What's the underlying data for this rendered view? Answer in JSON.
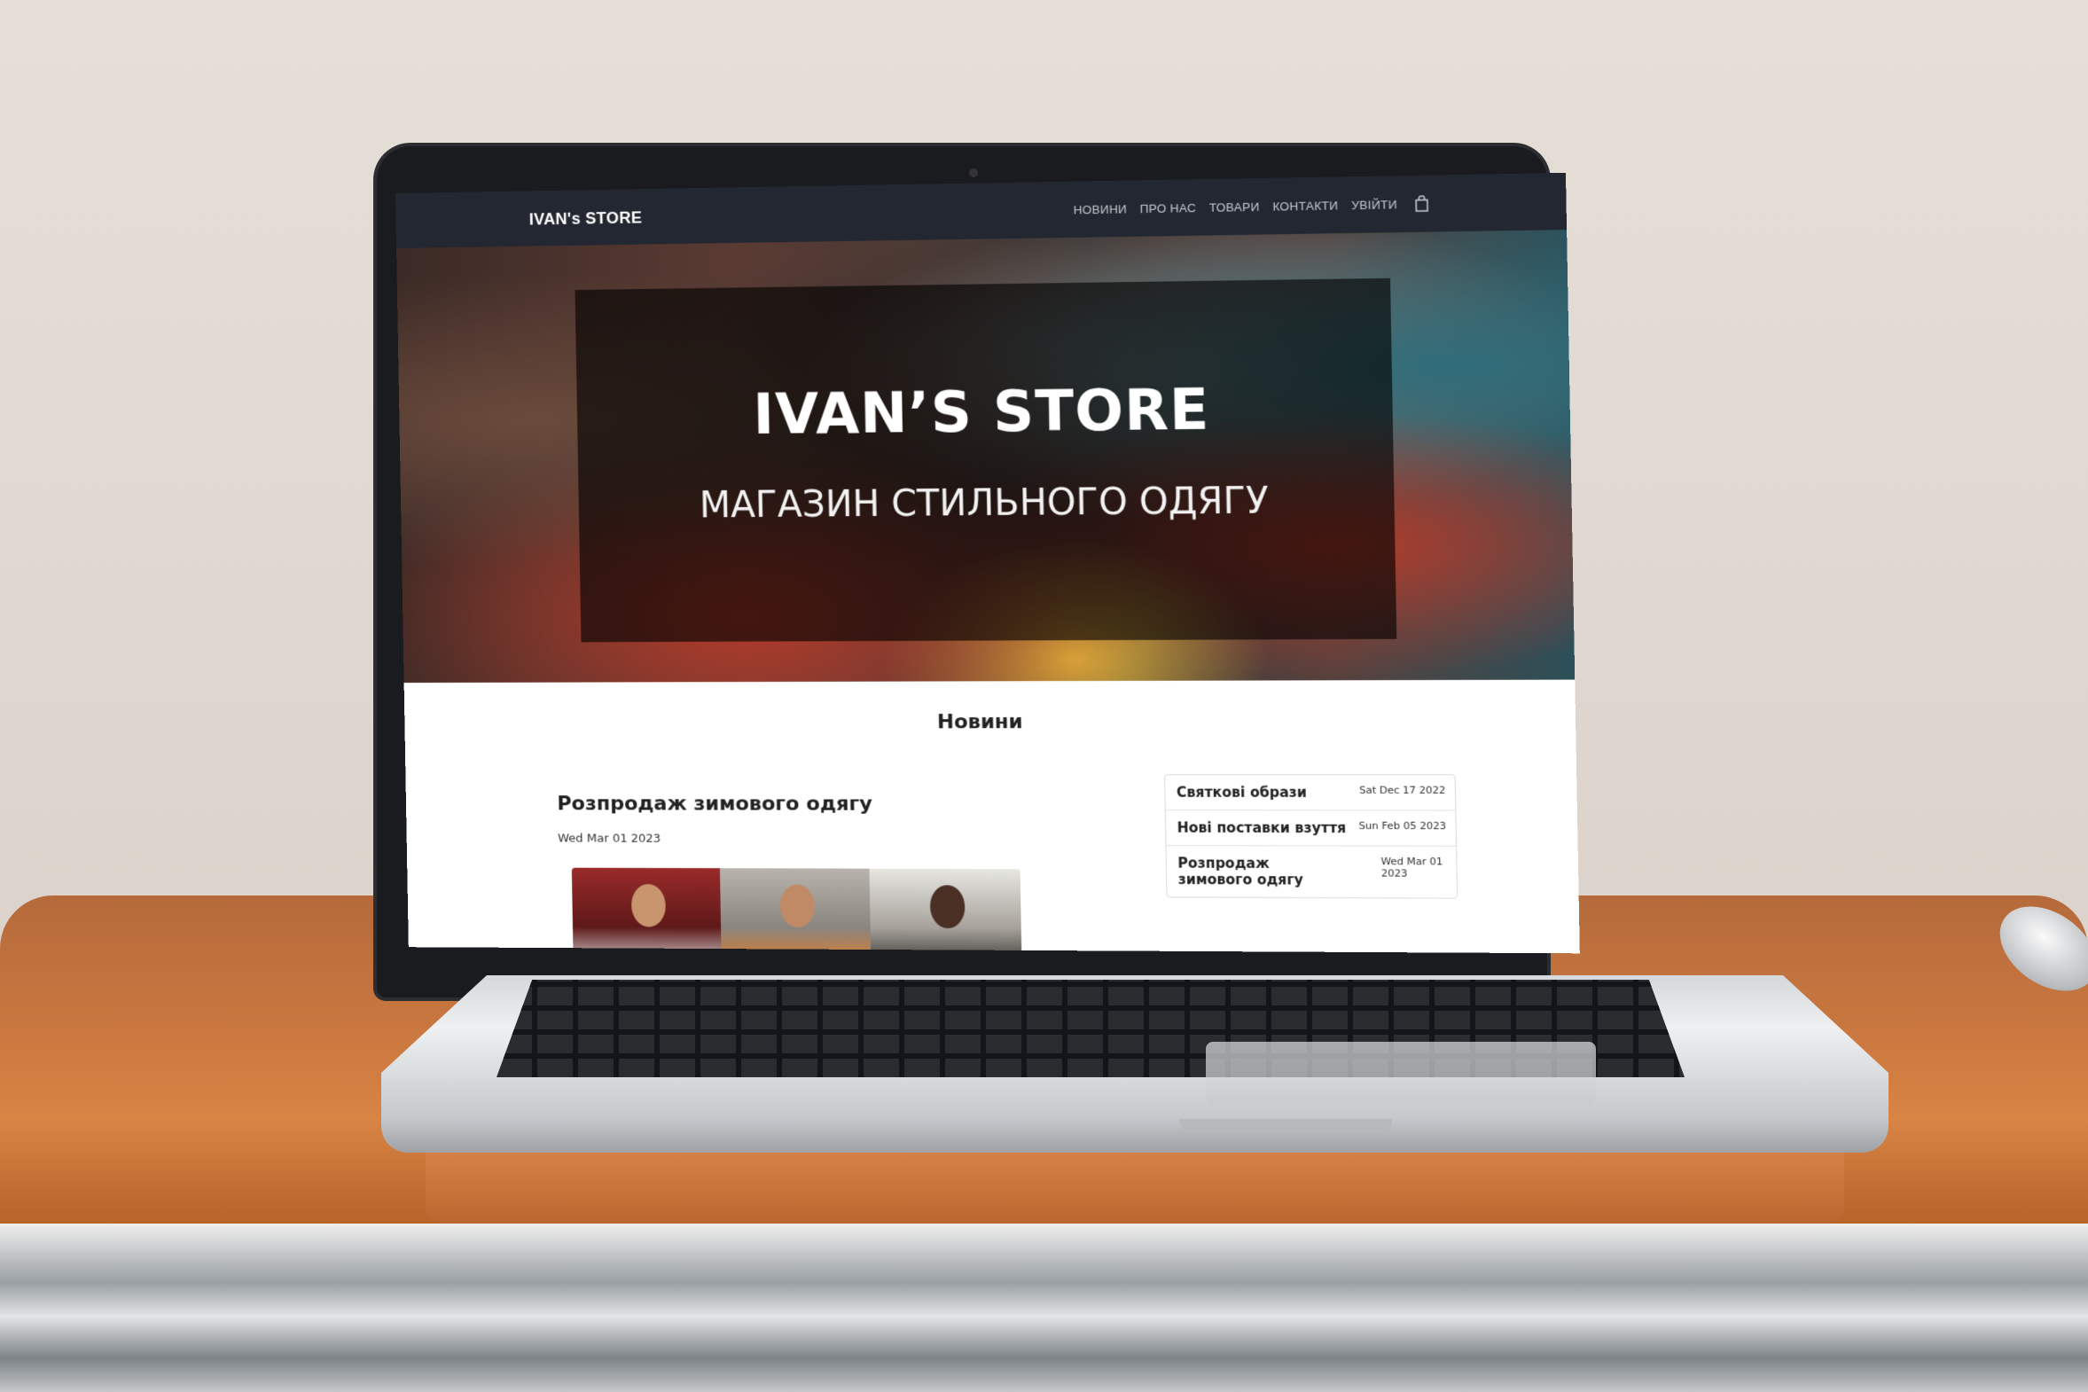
{
  "navbar": {
    "brand": "IVAN's STORE",
    "links": [
      "НОВИНИ",
      "ПРО НАС",
      "ТОВАРИ",
      "КОНТАКТИ",
      "УВІЙТИ"
    ],
    "cart_icon": "shopping-bag-icon"
  },
  "hero": {
    "title": "IVAN’S  STORE",
    "subtitle": "МАГАЗИН СТИЛЬНОГО ОДЯГУ"
  },
  "news": {
    "section_title": "Новини",
    "featured": {
      "title": "Розпродаж зимового одягу",
      "date": "Wed Mar 01 2023"
    },
    "sidebar": [
      {
        "title": "Святкові образи",
        "date": "Sat Dec 17 2022"
      },
      {
        "title": "Нові поставки взуття",
        "date": "Sun Feb 05 2023"
      },
      {
        "title": "Розпродаж зимового одягу",
        "date": "Wed Mar 01 2023"
      }
    ]
  },
  "colors": {
    "navbar_bg": "#222731",
    "hero_overlay": "rgba(0,0,0,0.62)",
    "text_dark": "#222222"
  }
}
